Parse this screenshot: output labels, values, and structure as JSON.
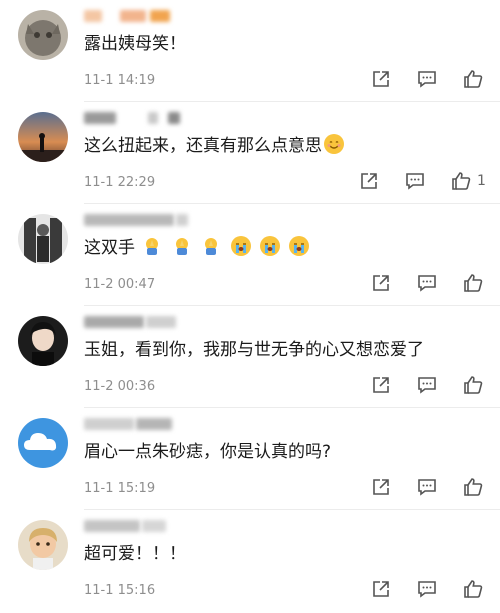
{
  "comments": [
    {
      "text": "露出姨母笑！",
      "time": "11-1 14:19",
      "likes": ""
    },
    {
      "text": "这么扭起来，还真有那么点意思",
      "time": "11-1 22:29",
      "likes": "1"
    },
    {
      "text": "这双手",
      "time": "11-2 00:47",
      "likes": ""
    },
    {
      "text": "玉姐，看到你，我那与世无争的心又想恋爱了",
      "time": "11-2 00:36",
      "likes": ""
    },
    {
      "text": "眉心一点朱砂痣，你是认真的吗?",
      "time": "11-1 15:19",
      "likes": ""
    },
    {
      "text": "超可爱！！！",
      "time": "11-1 15:16",
      "likes": ""
    }
  ],
  "icons": {
    "share": "share-icon",
    "reply": "comment-icon",
    "like": "thumbs-up-icon",
    "smile_emoji": "smile-emoji",
    "pray_emoji": "pray-emoji",
    "cry_emoji": "cry-emoji"
  },
  "colors": {
    "text": "#1b1b1b",
    "meta": "#8e8e8e",
    "icon": "#555555",
    "divider": "#ececec"
  }
}
